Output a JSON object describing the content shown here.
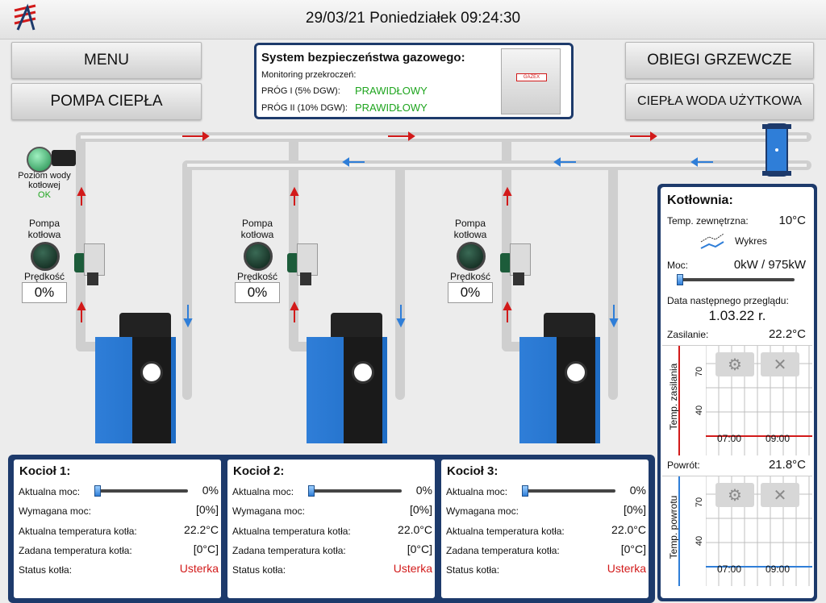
{
  "header": {
    "datetime": "29/03/21 Poniedziałek 09:24:30"
  },
  "nav": {
    "menu": "MENU",
    "heat_pump": "POMPA CIEPŁA",
    "heating_circuits": "OBIEGI GRZEWCZE",
    "hot_water": "CIEPŁA WODA UŻYTKOWA"
  },
  "gas": {
    "title": "System bezpieczeństwa gazowego:",
    "monitoring": "Monitoring przekroczeń:",
    "t1_label": "PRÓG I (5% DGW):",
    "t1_value": "PRAWIDŁOWY",
    "t2_label": "PRÓG II (10% DGW):",
    "t2_value": "PRAWIDŁOWY",
    "device_label": "GAZEX"
  },
  "water_level": {
    "label1": "Poziom wody",
    "label2": "kotłowej",
    "status": "OK"
  },
  "pumps": [
    {
      "label1": "Pompa",
      "label2": "kotłowa",
      "speed_label": "Prędkość",
      "speed": "0%"
    },
    {
      "label1": "Pompa",
      "label2": "kotłowa",
      "speed_label": "Prędkość",
      "speed": "0%"
    },
    {
      "label1": "Pompa",
      "label2": "kotłowa",
      "speed_label": "Prędkość",
      "speed": "0%"
    }
  ],
  "boiler_labels": {
    "power": "Aktualna moc:",
    "required": "Wymagana moc:",
    "temp": "Aktualna temperatura kotła:",
    "set_temp": "Zadana temperatura kotła:",
    "status": "Status kotła:"
  },
  "boilers": [
    {
      "title": "Kocioł 1:",
      "power": "0%",
      "power_level": 0,
      "required": "[0%]",
      "temp": "22.2°C",
      "set_temp": "[0°C]",
      "status": "Usterka"
    },
    {
      "title": "Kocioł 2:",
      "power": "0%",
      "power_level": 0,
      "required": "[0%]",
      "temp": "22.0°C",
      "set_temp": "[0°C]",
      "status": "Usterka"
    },
    {
      "title": "Kocioł 3:",
      "power": "0%",
      "power_level": 0,
      "required": "[0%]",
      "temp": "22.0°C",
      "set_temp": "[0°C]",
      "status": "Usterka"
    }
  ],
  "kotlownia": {
    "title": "Kotłownia:",
    "ext_temp_label": "Temp. zewnętrzna:",
    "ext_temp": "10°C",
    "chart_link": "Wykres",
    "power_label": "Moc:",
    "power": "0kW / 975kW",
    "power_level": 0,
    "service_label": "Data następnego przeglądu:",
    "service_date": "1.03.22 r.",
    "supply_label": "Zasilanie:",
    "supply": "22.2°C",
    "return_label": "Powrót:",
    "return": "21.8°C"
  },
  "chart_data": [
    {
      "type": "line",
      "ylabel": "Temp. zasilania",
      "yticks": [
        "40",
        "70"
      ],
      "xticks": [
        "07:00",
        "09:00"
      ],
      "color": "#d21a1a"
    },
    {
      "type": "line",
      "ylabel": "Temp. powrotu",
      "yticks": [
        "40",
        "70"
      ],
      "xticks": [
        "07:00",
        "09:00"
      ],
      "color": "#2f7ed8"
    }
  ],
  "colors": {
    "panel_border": "#1d3a6b",
    "ok": "#1fa51f",
    "error": "#d21a1a",
    "boiler": "#2f7ed8",
    "pipe": "#d8d8d8"
  }
}
